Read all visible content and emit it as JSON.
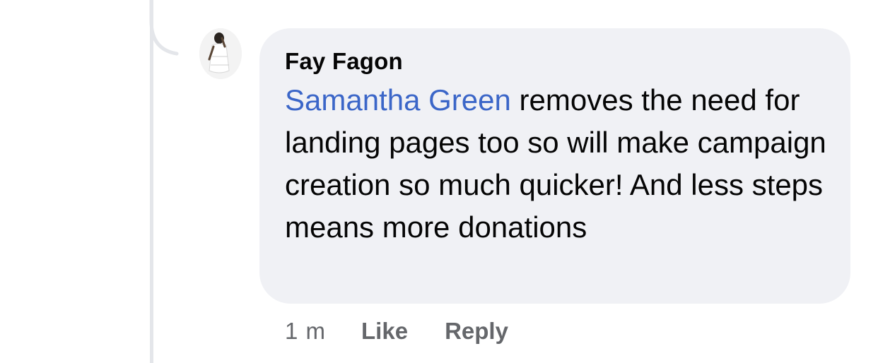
{
  "comment": {
    "author": "Fay Fagon",
    "mention": "Samantha Green",
    "text": " removes the need for landing pages too so will make campaign creation so much quicker! And less steps means more donations",
    "timestamp": "1 m",
    "actions": {
      "like_label": "Like",
      "reply_label": "Reply"
    }
  },
  "colors": {
    "bubble": "#f0f1f5",
    "mention": "#3b66c8",
    "meta": "#65676b",
    "thread_line": "#e4e6ea"
  },
  "icons": {
    "avatar": "profile-photo"
  }
}
